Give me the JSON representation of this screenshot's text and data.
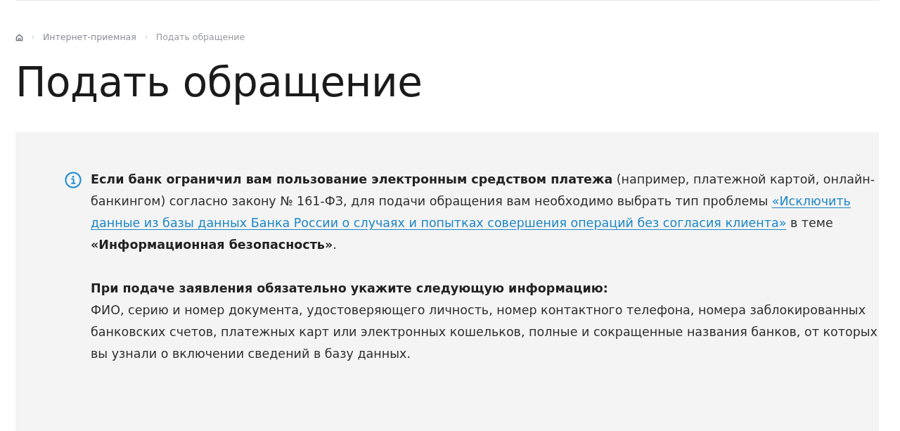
{
  "breadcrumbs": [
    {
      "kind": "home"
    },
    {
      "kind": "link",
      "label": "Интернет-приемная"
    },
    {
      "kind": "current",
      "label": "Подать обращение"
    }
  ],
  "title": "Подать обращение",
  "notice": {
    "blocks": [
      {
        "kind": "paragraph",
        "segments": [
          {
            "kind": "text",
            "text": "**Если банк ограничил вам пользование электронным средством платежа** (например, платежной картой, онлайн-банкингом) согласно закону № 161-ФЗ, для подачи обращения вам необходимо выбрать тип проблемы"
          },
          {
            "kind": "link",
            "text": "«Исключить"
          },
          {
            "kind": "link",
            "text": "данные из базы данных Банка России о случаях и попытках совершения операций без согласия клиента»"
          },
          {
            "kind": "text",
            "text": "в теме **«Информационная безопасность»**."
          }
        ]
      },
      {
        "kind": "heading",
        "text": "При подаче заявления обязательно укажите следующую информацию:"
      },
      {
        "kind": "paragraph",
        "segments": [
          {
            "kind": "text",
            "text": "ФИО, серию и номер документа, удостоверяющего личность, номер контактного телефона, номера заблокированных банковских счетов, платежных карт или электронных кошельков, полные и сокращенные названия банков, от которых вы узнали о включении сведений в базу данных."
          }
        ]
      }
    ]
  }
}
